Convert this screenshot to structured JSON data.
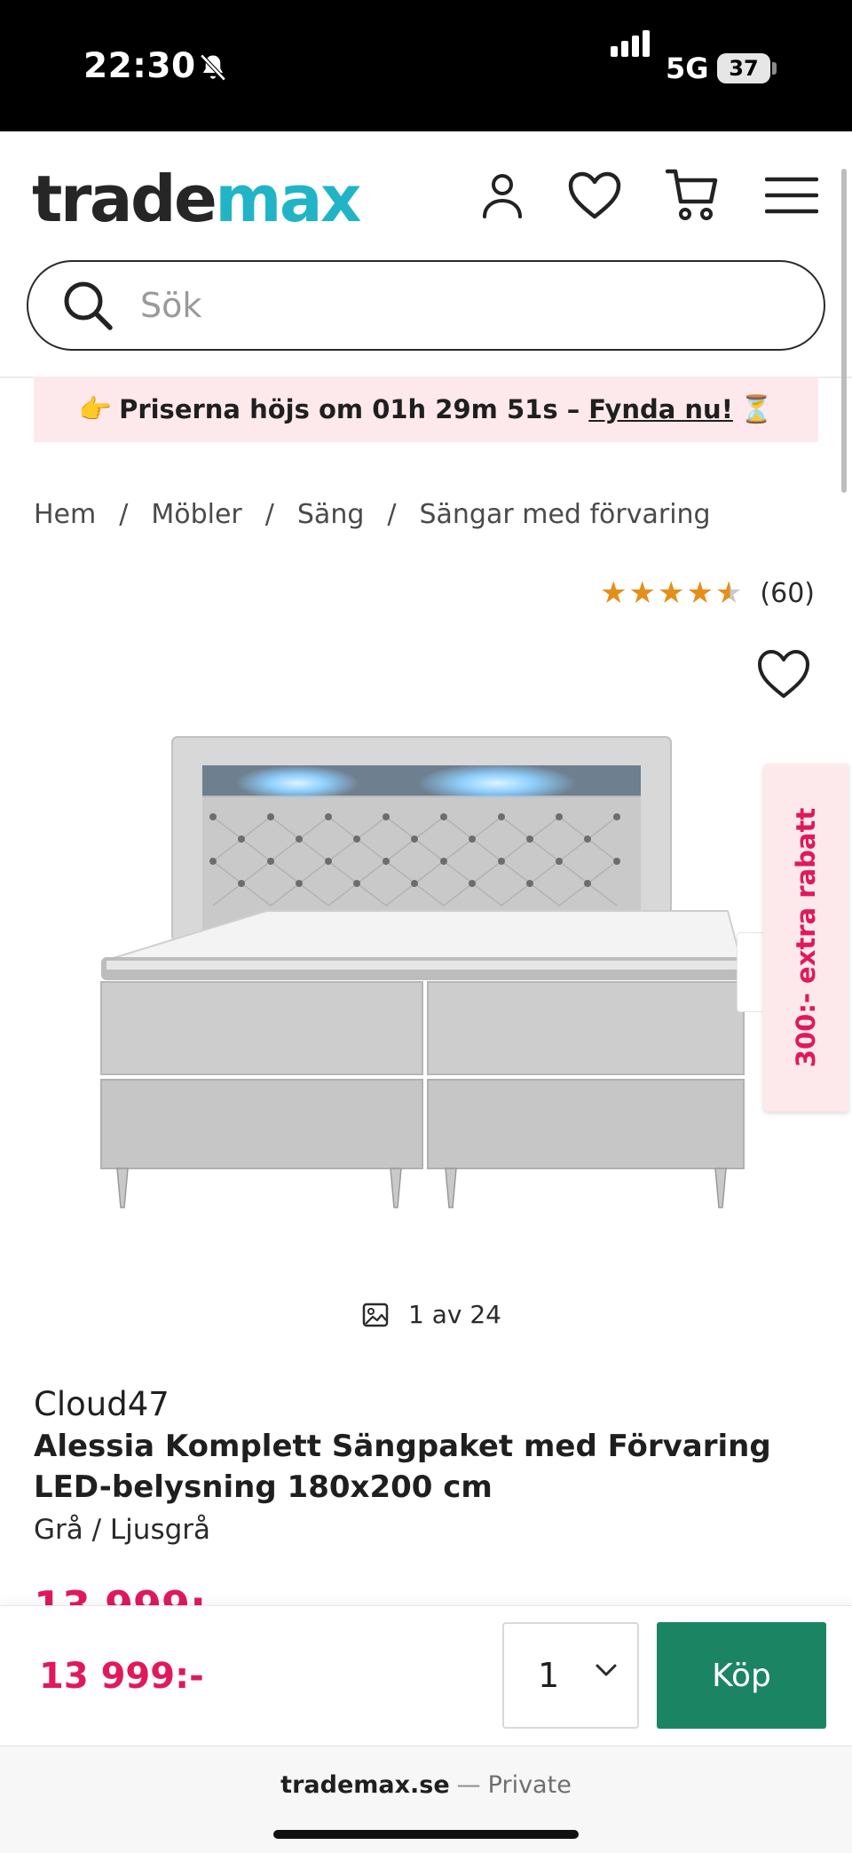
{
  "status_bar": {
    "time": "22:30",
    "network": "5G",
    "battery": "37"
  },
  "header": {
    "logo": {
      "part_a": "trade",
      "part_b": "max"
    },
    "search": {
      "placeholder": "Sök"
    }
  },
  "promo": {
    "lead_emoji": "👉",
    "text": "Priserna höjs om 01h 29m 51s – ",
    "cta": "Fynda nu!",
    "trail_emoji": "⏳"
  },
  "breadcrumb": {
    "items": [
      "Hem",
      "Möbler",
      "Säng",
      "Sängar med förvaring"
    ],
    "separator": "/"
  },
  "rating": {
    "value": 4.5,
    "count_label": "(60)"
  },
  "gallery": {
    "counter": "1 av 24"
  },
  "discount_tab": {
    "label": "300:- extra rabatt"
  },
  "product": {
    "brand": "Cloud47",
    "title": "Alessia Komplett Sängpaket med Förvaring LED-belysning 180x200 cm",
    "variant": "Grå / Ljusgrå"
  },
  "purchase": {
    "price": "13 999:-",
    "quantity": "1",
    "buy_label": "Köp"
  },
  "browser": {
    "domain": "trademax.se",
    "separator": "—",
    "mode": "Private"
  },
  "colors": {
    "brand_teal": "#21b4c7",
    "sale_pink": "#e0195b",
    "buy_green": "#1b8463",
    "star_orange": "#e48f1c",
    "promo_bg": "#fde9ec"
  },
  "icons": [
    "bell-slash-icon",
    "signal-icon",
    "user-icon",
    "heart-icon",
    "cart-icon",
    "menu-icon",
    "search-icon",
    "star-icon",
    "image-icon",
    "chevron-down-icon"
  ]
}
